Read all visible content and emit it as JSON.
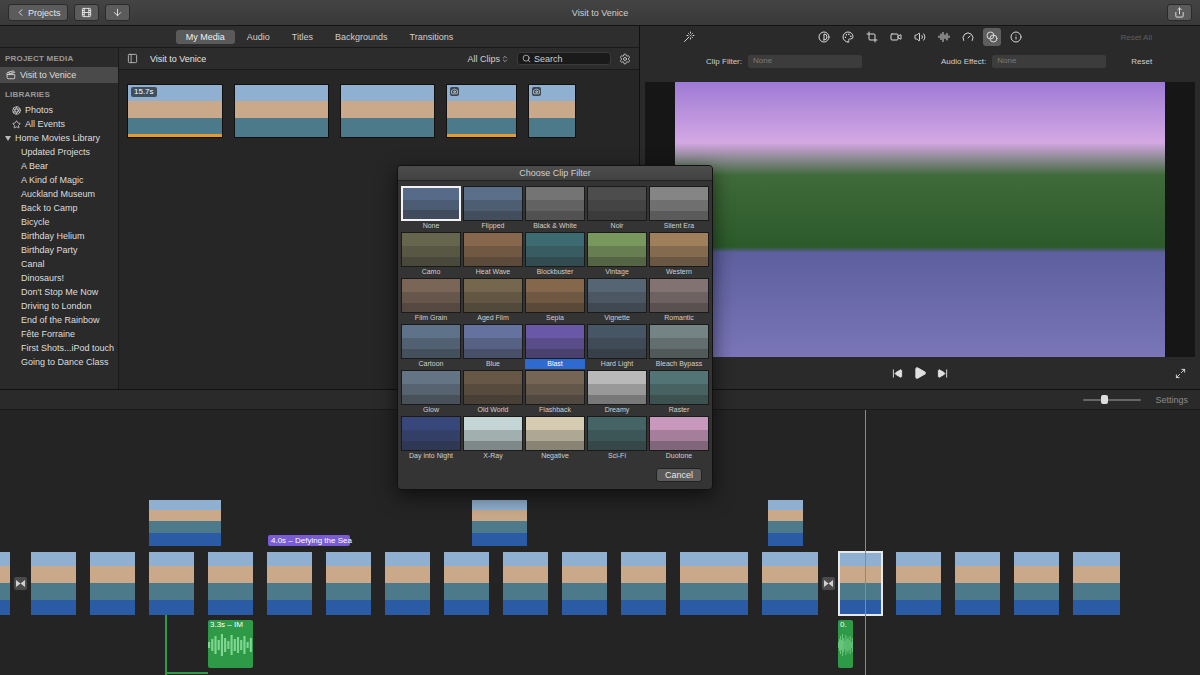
{
  "window": {
    "title": "Visit to Venice"
  },
  "top_bar": {
    "projects_button": "Projects"
  },
  "media_tabs": [
    {
      "label": "My Media",
      "selected": true
    },
    {
      "label": "Audio",
      "selected": false
    },
    {
      "label": "Titles",
      "selected": false
    },
    {
      "label": "Backgrounds",
      "selected": false
    },
    {
      "label": "Transitions",
      "selected": false
    }
  ],
  "sidebar": {
    "project_header": "PROJECT MEDIA",
    "project": {
      "label": "Visit to Venice",
      "selected": true
    },
    "libraries_header": "LIBRARIES",
    "libraries": [
      {
        "label": "Photos",
        "selected": false
      },
      {
        "label": "All Events",
        "selected": false
      }
    ],
    "library": {
      "label": "Home Movies Library",
      "expanded": true
    },
    "events": [
      {
        "label": "Updated Projects",
        "selected": false
      },
      {
        "label": "A Bear",
        "selected": false
      },
      {
        "label": "A Kind of Magic",
        "selected": false
      },
      {
        "label": "Auckland Museum",
        "selected": false
      },
      {
        "label": "Back to Camp",
        "selected": false
      },
      {
        "label": "Bicycle",
        "selected": false
      },
      {
        "label": "Birthday Helium",
        "selected": false
      },
      {
        "label": "Birthday Party",
        "selected": false
      },
      {
        "label": "Canal",
        "selected": false
      },
      {
        "label": "Dinosaurs!",
        "selected": false
      },
      {
        "label": "Don't Stop Me Now",
        "selected": false
      },
      {
        "label": "Driving to London",
        "selected": false
      },
      {
        "label": "End of the Rainbow",
        "selected": false
      },
      {
        "label": "Fête Forraine",
        "selected": false
      },
      {
        "label": "First Shots...iPod touch",
        "selected": false
      },
      {
        "label": "Going to Dance Class",
        "selected": false
      }
    ]
  },
  "browser": {
    "title": "Visit to Venice",
    "filter": "All Clips",
    "search_placeholder": "Search",
    "clips": [
      {
        "kind": "video",
        "duration": "15.7s",
        "used": true
      },
      {
        "kind": "video",
        "used": false
      },
      {
        "kind": "video",
        "used": false
      },
      {
        "kind": "photo",
        "used": true
      },
      {
        "kind": "photo",
        "used": false
      }
    ]
  },
  "viewer": {
    "tools": [
      {
        "selected": false
      },
      {
        "selected": false
      },
      {
        "selected": false
      },
      {
        "selected": false
      },
      {
        "selected": false
      },
      {
        "selected": false
      },
      {
        "selected": false
      },
      {
        "selected": true
      },
      {
        "selected": false
      }
    ],
    "reset_all": {
      "label": "Reset All",
      "disabled": true
    },
    "clip_filter": {
      "label": "Clip Filter:",
      "value": "None"
    },
    "audio_effect": {
      "label": "Audio Effect:",
      "value": "None"
    },
    "reset": "Reset"
  },
  "timeline": {
    "settings": "Settings",
    "zoom": {
      "level": 0.35
    },
    "track": [
      {
        "kind": "clip",
        "selected": false
      },
      {
        "kind": "transition",
        "selected": false
      },
      {
        "kind": "clip",
        "selected": false
      },
      {
        "kind": "clip",
        "selected": false
      },
      {
        "kind": "clip",
        "selected": false
      },
      {
        "kind": "clip",
        "selected": false
      },
      {
        "kind": "clip",
        "selected": false
      },
      {
        "kind": "clip",
        "selected": false
      },
      {
        "kind": "clip",
        "selected": false
      },
      {
        "kind": "clip",
        "selected": false
      },
      {
        "kind": "clip",
        "selected": false
      },
      {
        "kind": "clip",
        "selected": false
      },
      {
        "kind": "clip",
        "selected": false
      },
      {
        "kind": "clip",
        "selected": false
      },
      {
        "kind": "clip",
        "selected": false
      },
      {
        "kind": "transition",
        "selected": false
      },
      {
        "kind": "clip",
        "selected": true
      },
      {
        "kind": "clip",
        "selected": false
      },
      {
        "kind": "clip",
        "selected": false
      },
      {
        "kind": "clip",
        "selected": false
      },
      {
        "kind": "clip",
        "selected": false
      }
    ],
    "cutaways": [
      {
        "selected": false
      },
      {
        "selected": false
      },
      {
        "selected": false
      }
    ],
    "title_clip": "4.0s – Defying the Sea",
    "audio_clips": [
      {
        "label": "3.3s – IM"
      },
      {
        "label": "0."
      }
    ]
  },
  "filter_dialog": {
    "title": "Choose Clip Filter",
    "cancel": "Cancel",
    "filters": [
      {
        "label": "None",
        "applied": true,
        "selected": false,
        "color": "#5a7090"
      },
      {
        "label": "Flipped",
        "applied": false,
        "selected": false,
        "color": "#5e7490"
      },
      {
        "label": "Black & White",
        "applied": false,
        "selected": false,
        "color": "#7a7a7a"
      },
      {
        "label": "Noir",
        "applied": false,
        "selected": false,
        "color": "#505050"
      },
      {
        "label": "Silent Era",
        "applied": false,
        "selected": false,
        "color": "#8c8c8c"
      },
      {
        "label": "Camo",
        "applied": false,
        "selected": false,
        "color": "#6b6a50"
      },
      {
        "label": "Heat Wave",
        "applied": false,
        "selected": false,
        "color": "#8e6c50"
      },
      {
        "label": "Blockbuster",
        "applied": false,
        "selected": false,
        "color": "#3f7078"
      },
      {
        "label": "Vintage",
        "applied": false,
        "selected": false,
        "color": "#7fa062"
      },
      {
        "label": "Western",
        "applied": false,
        "selected": false,
        "color": "#a88660"
      },
      {
        "label": "Film Grain",
        "applied": false,
        "selected": false,
        "color": "#806a5a"
      },
      {
        "label": "Aged Film",
        "applied": false,
        "selected": false,
        "color": "#7a6a50"
      },
      {
        "label": "Sepia",
        "applied": false,
        "selected": false,
        "color": "#8c6c4e"
      },
      {
        "label": "Vignette",
        "applied": false,
        "selected": false,
        "color": "#5a6a7a"
      },
      {
        "label": "Romantic",
        "applied": false,
        "selected": false,
        "color": "#8a7878"
      },
      {
        "label": "Cartoon",
        "applied": false,
        "selected": false,
        "color": "#627890"
      },
      {
        "label": "Blue",
        "applied": false,
        "selected": false,
        "color": "#6a78a8"
      },
      {
        "label": "Blast",
        "applied": false,
        "selected": true,
        "color": "#6e5cb0"
      },
      {
        "label": "Hard Light",
        "applied": false,
        "selected": false,
        "color": "#4a5a6a"
      },
      {
        "label": "Bleach Bypass",
        "applied": false,
        "selected": false,
        "color": "#7a8a8a"
      },
      {
        "label": "Glow",
        "applied": false,
        "selected": false,
        "color": "#6a7a8c"
      },
      {
        "label": "Old World",
        "applied": false,
        "selected": false,
        "color": "#6a5a48"
      },
      {
        "label": "Flashback",
        "applied": false,
        "selected": false,
        "color": "#7a6a58"
      },
      {
        "label": "Dreamy",
        "applied": false,
        "selected": false,
        "color": "#c4c4c4"
      },
      {
        "label": "Raster",
        "applied": false,
        "selected": false,
        "color": "#567a7a"
      },
      {
        "label": "Day into Night",
        "applied": false,
        "selected": false,
        "color": "#3a4a80"
      },
      {
        "label": "X-Ray",
        "applied": false,
        "selected": false,
        "color": "#d0e2e2"
      },
      {
        "label": "Negative",
        "applied": false,
        "selected": false,
        "color": "#e2d8bc"
      },
      {
        "label": "Sci-Fi",
        "applied": false,
        "selected": false,
        "color": "#46686a"
      },
      {
        "label": "Duotone",
        "applied": false,
        "selected": false,
        "color": "#d4a0c8"
      }
    ]
  }
}
